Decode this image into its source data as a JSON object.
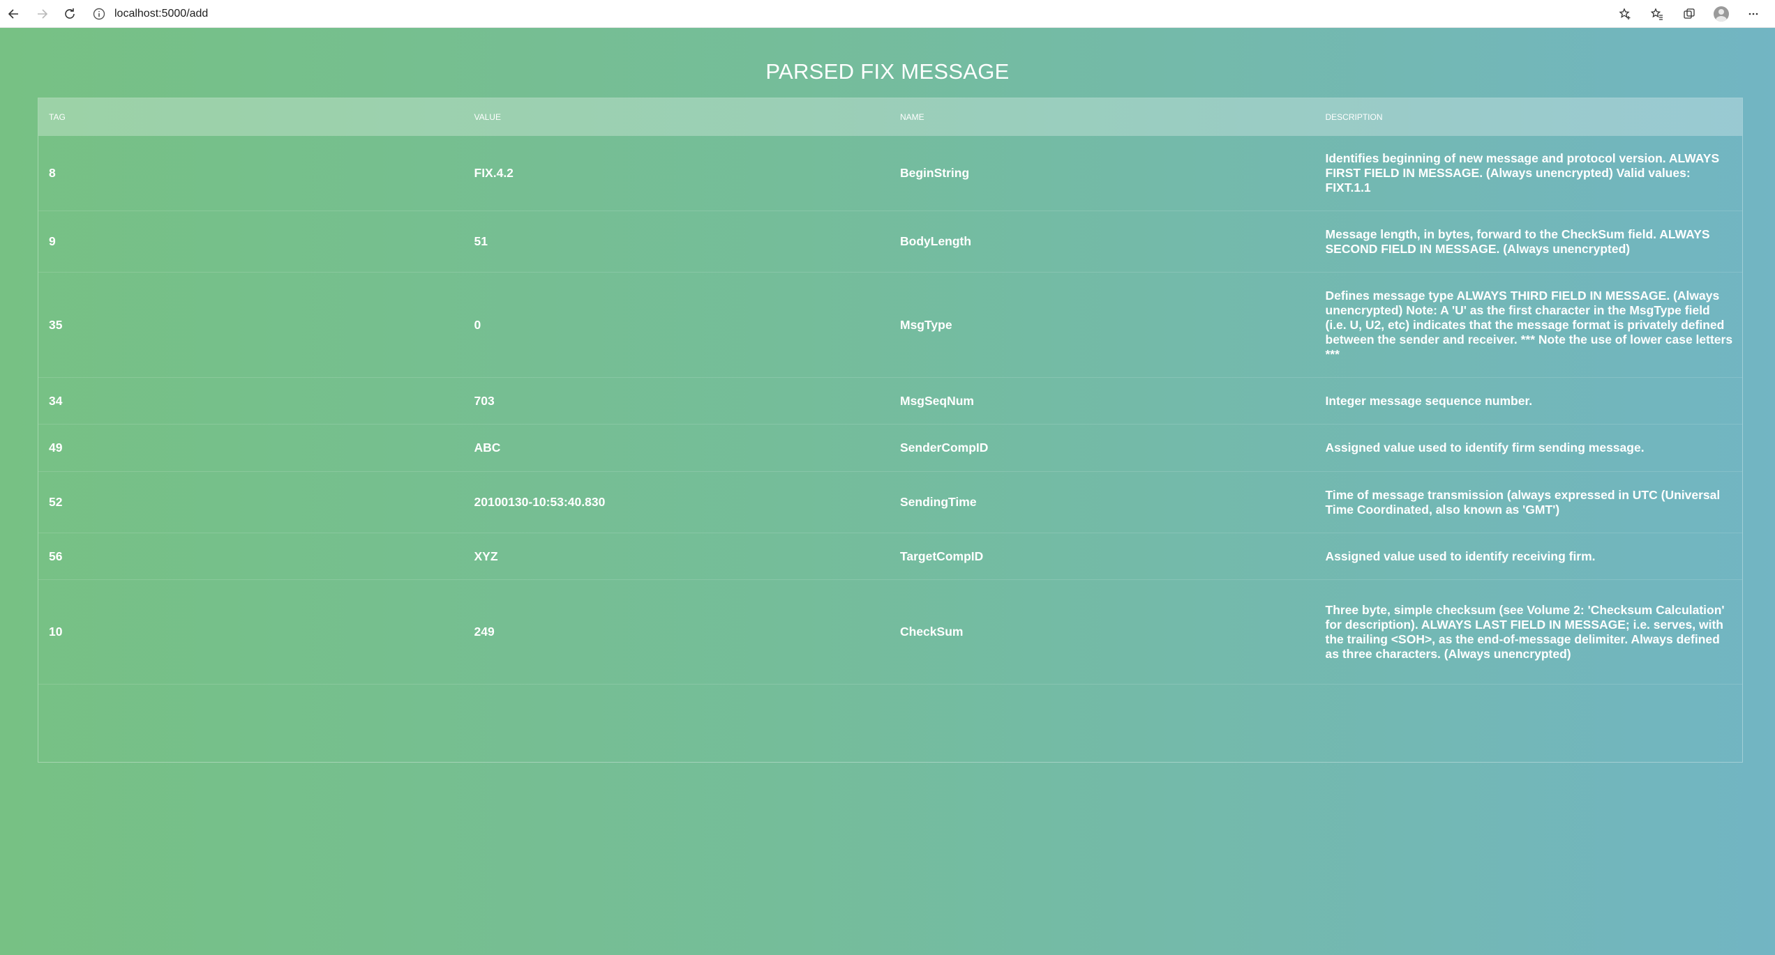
{
  "browser": {
    "url": "localhost:5000/add"
  },
  "page": {
    "title": "PARSED FIX MESSAGE",
    "columns": {
      "tag": "TAG",
      "value": "VALUE",
      "name": "NAME",
      "description": "DESCRIPTION"
    },
    "rows": [
      {
        "tag": "8",
        "value": "FIX.4.2",
        "name": "BeginString",
        "description": "Identifies beginning of new message and protocol version. ALWAYS FIRST FIELD IN MESSAGE. (Always unencrypted) Valid values: FIXT.1.1"
      },
      {
        "tag": "9",
        "value": "51",
        "name": "BodyLength",
        "description": "Message length, in bytes, forward to the CheckSum field. ALWAYS SECOND FIELD IN MESSAGE. (Always unencrypted)"
      },
      {
        "tag": "35",
        "value": "0",
        "name": "MsgType",
        "description": "Defines message type ALWAYS THIRD FIELD IN MESSAGE. (Always unencrypted) Note: A 'U' as the first character in the MsgType field (i.e. U, U2, etc) indicates that the message format is privately defined between the sender and receiver. *** Note the use of lower case letters ***"
      },
      {
        "tag": "34",
        "value": "703",
        "name": "MsgSeqNum",
        "description": "Integer message sequence number."
      },
      {
        "tag": "49",
        "value": "ABC",
        "name": "SenderCompID",
        "description": "Assigned value used to identify firm sending message."
      },
      {
        "tag": "52",
        "value": "20100130-10:53:40.830",
        "name": "SendingTime",
        "description": "Time of message transmission (always expressed in UTC (Universal Time Coordinated, also known as 'GMT')"
      },
      {
        "tag": "56",
        "value": "XYZ",
        "name": "TargetCompID",
        "description": "Assigned value used to identify receiving firm."
      },
      {
        "tag": "10",
        "value": "249",
        "name": "CheckSum",
        "description": "Three byte, simple checksum (see Volume 2: 'Checksum Calculation' for description). ALWAYS LAST FIELD IN MESSAGE; i.e. serves, with the trailing <SOH>, as the end-of-message delimiter. Always defined as three characters. (Always unencrypted)"
      }
    ]
  }
}
